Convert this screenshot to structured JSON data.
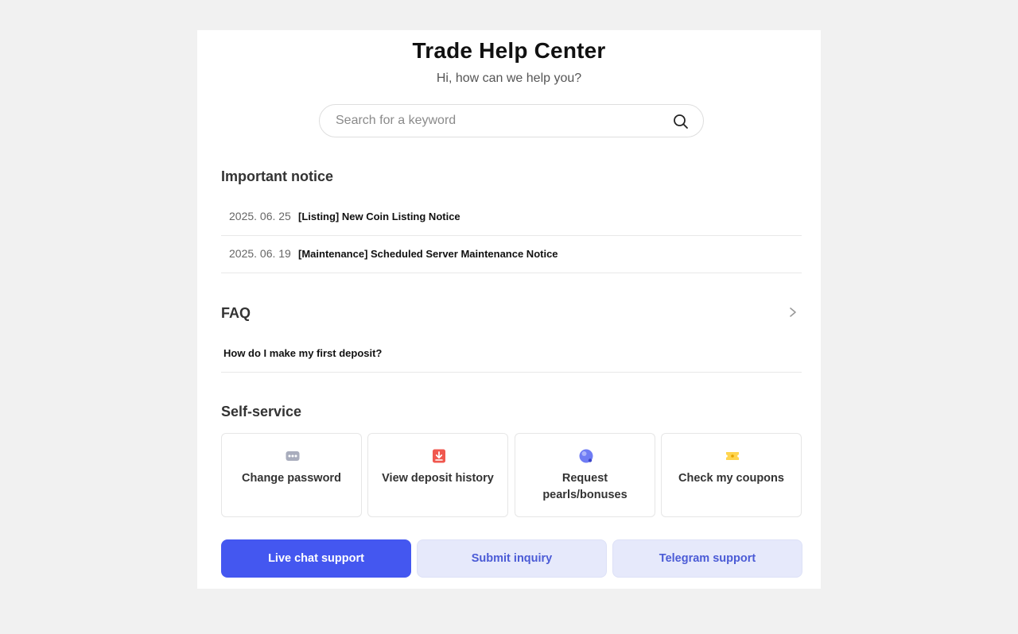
{
  "header": {
    "title": "Trade Help Center",
    "subtitle": "Hi, how can we help you?"
  },
  "search": {
    "placeholder": "Search for a keyword",
    "value": "",
    "icon": "search-icon"
  },
  "notices": {
    "title": "Important notice",
    "items": [
      {
        "date": "2025. 06. 25",
        "text": "[Listing] New Coin Listing Notice"
      },
      {
        "date": "2025. 06. 19",
        "text": "[Maintenance] Scheduled Server Maintenance Notice"
      }
    ]
  },
  "faq": {
    "title": "FAQ",
    "icon": "chevron-right-icon",
    "items": [
      {
        "text": "How do I make my first deposit?"
      }
    ]
  },
  "self_service": {
    "title": "Self-service",
    "tiles": [
      {
        "label": "Change password",
        "icon": "password-icon",
        "color": "#a9adbd"
      },
      {
        "label": "View deposit history",
        "icon": "deposit-download-icon",
        "color": "#f0584f"
      },
      {
        "label": "Request pearls/bonuses",
        "icon": "pearl-icon",
        "color": "#6f7cf4"
      },
      {
        "label": "Check my coupons",
        "icon": "coupon-icon",
        "color": "#ffd54f"
      }
    ]
  },
  "actions": {
    "live_chat": "Live chat support",
    "submit_inquiry": "Submit inquiry",
    "telegram": "Telegram support"
  },
  "colors": {
    "accent": "#4457f0",
    "soft_button_bg": "#e6e9fb",
    "soft_button_text": "#4b5bd6",
    "page_bg": "#f1f1f1"
  }
}
